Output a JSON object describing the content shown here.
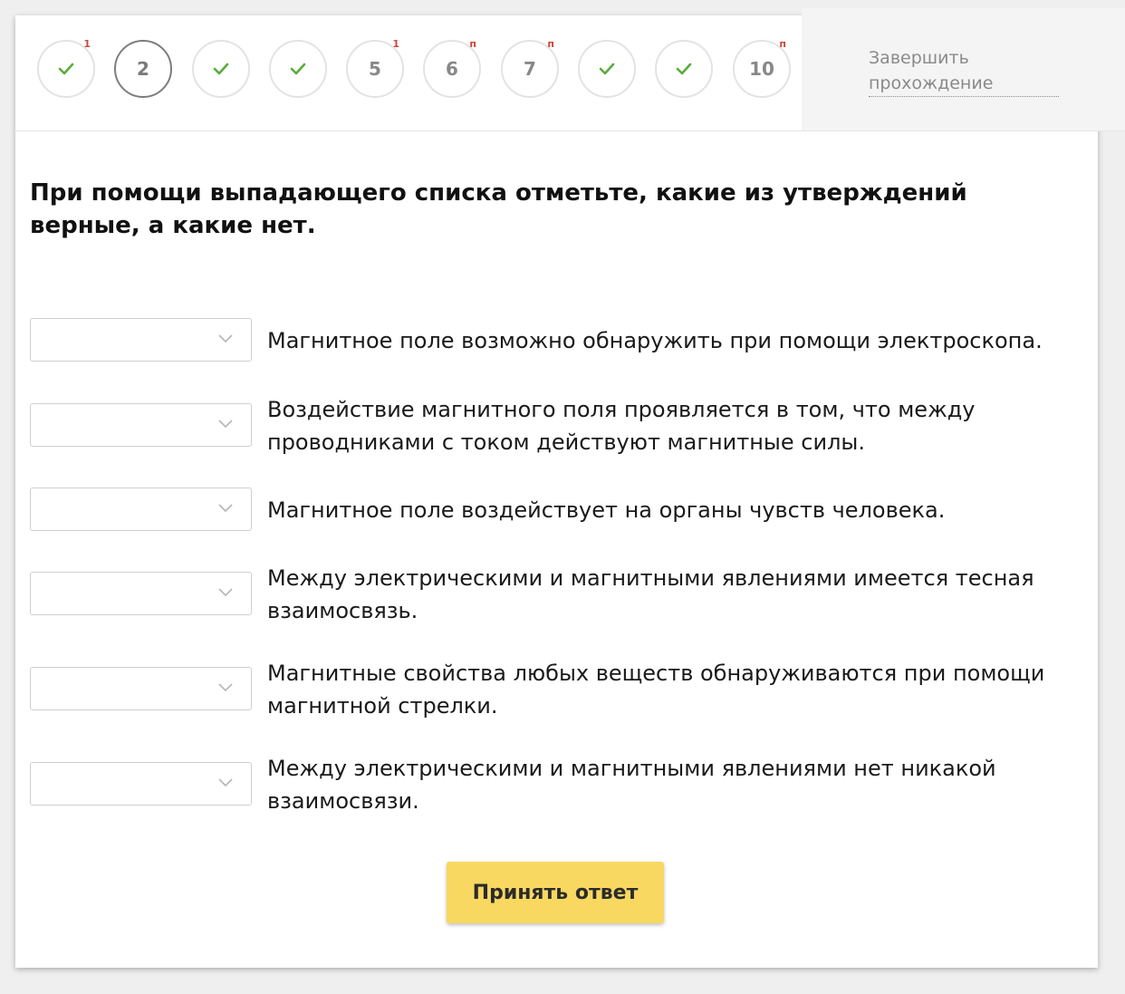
{
  "steps": [
    {
      "label": "",
      "state": "done",
      "badge": "1"
    },
    {
      "label": "2",
      "state": "current",
      "badge": ""
    },
    {
      "label": "",
      "state": "done",
      "badge": ""
    },
    {
      "label": "",
      "state": "done",
      "badge": ""
    },
    {
      "label": "5",
      "state": "pending",
      "badge": "1"
    },
    {
      "label": "6",
      "state": "pending",
      "badge": "п"
    },
    {
      "label": "7",
      "state": "pending",
      "badge": "п"
    },
    {
      "label": "",
      "state": "done",
      "badge": ""
    },
    {
      "label": "",
      "state": "done",
      "badge": ""
    },
    {
      "label": "10",
      "state": "pending",
      "badge": "п"
    }
  ],
  "finish": {
    "label": "Завершить прохождение"
  },
  "question": "При помощи выпадающего списка отметьте, какие из утверждений верные, а какие нет.",
  "statements": [
    {
      "text": "Магнитное поле возможно обнаружить при помощи электроскопа.",
      "selected": ""
    },
    {
      "text": "Воздействие магнитного поля проявляется в том, что между проводниками с током действуют магнитные силы.",
      "selected": ""
    },
    {
      "text": "Магнитное поле воздействует на органы чувств человека.",
      "selected": ""
    },
    {
      "text": "Между электрическими и магнитными явлениями имеется тесная взаимосвязь.",
      "selected": ""
    },
    {
      "text": "Магнитные свойства любых веществ обнаруживаются при помощи магнитной стрелки.",
      "selected": ""
    },
    {
      "text": "Между электрическими и магнитными явлениями нет никакой взаимосвязи.",
      "selected": ""
    }
  ],
  "submit": {
    "label": "Принять ответ"
  },
  "colors": {
    "check": "#5aab3c",
    "badge": "#d0453a",
    "accent": "#f8d860"
  },
  "icons": {
    "done": "check-icon",
    "dropdown": "chevron-down-icon"
  }
}
